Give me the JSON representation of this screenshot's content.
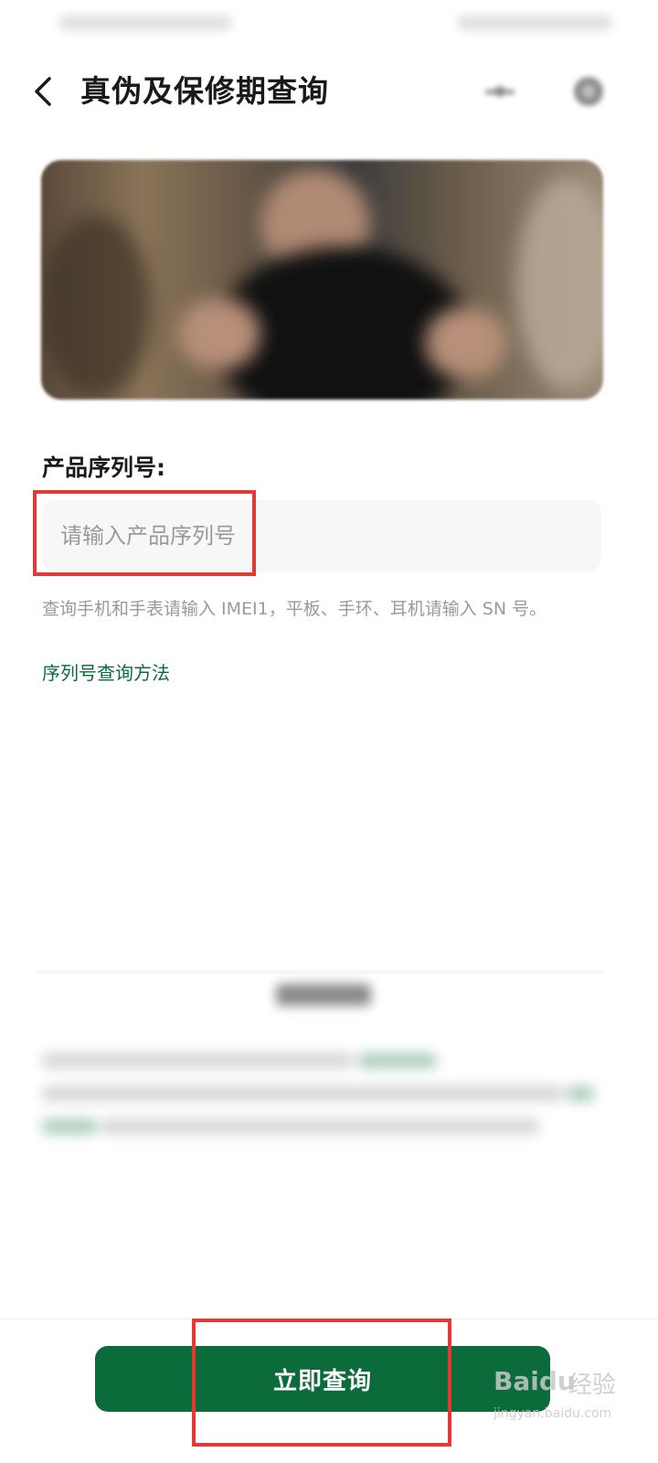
{
  "header": {
    "title": "真伪及保修期查询",
    "back_icon": "chevron-left-icon",
    "share_icon": "share-icon",
    "more_icon": "more-icon"
  },
  "serial": {
    "label": "产品序列号:",
    "placeholder": "请输入产品序列号",
    "hint": "查询手机和手表请输入 IMEI1，平板、手环、耳机请输入 SN 号。",
    "help_link": "序列号查询方法"
  },
  "footer": {
    "query_button": "立即查询"
  },
  "watermark": {
    "brand": "Baidu",
    "brand_cn": "经验",
    "url": "jingyan.baidu.com"
  },
  "colors": {
    "accent": "#0b6b3a",
    "highlight": "#e53935",
    "title": "#1a1a1a",
    "hint": "#9a9a9a"
  }
}
